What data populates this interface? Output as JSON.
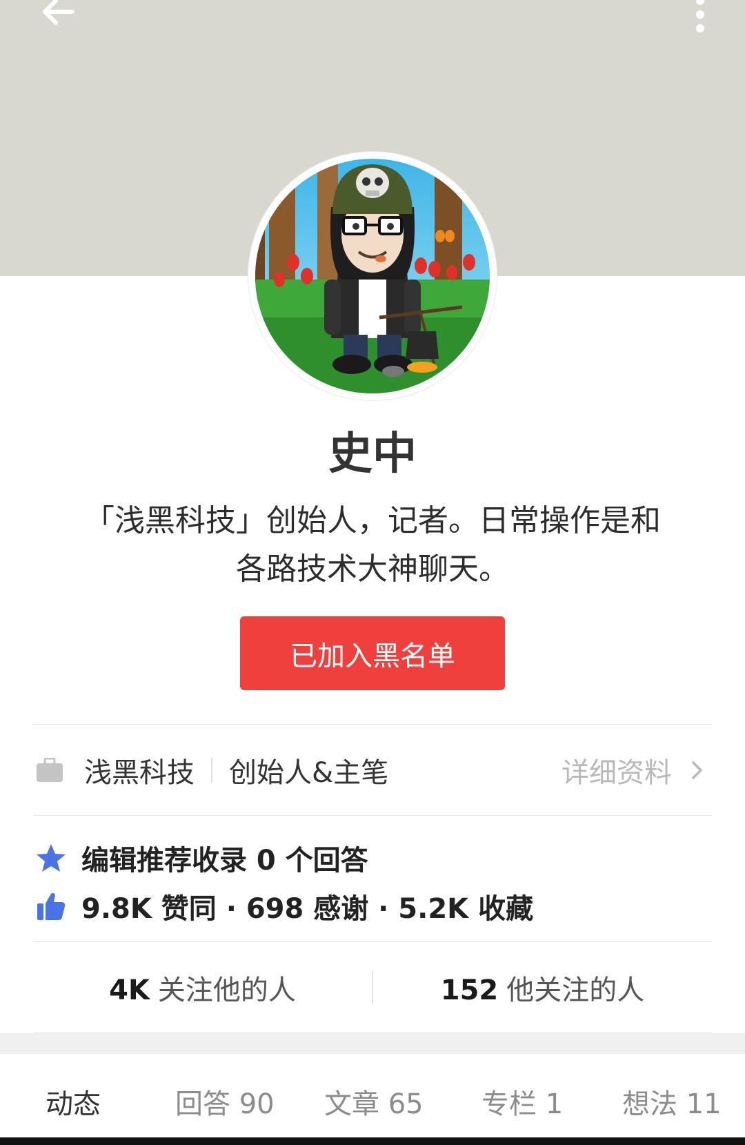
{
  "header": {
    "back_icon": "arrow-left-icon",
    "more_icon": "vertical-dots-icon",
    "cover_color": "#d8d7d0"
  },
  "profile": {
    "avatar": "cartoon-avatar",
    "name": "史中",
    "headline": "「浅黑科技」创始人，记者。日常操作是和各路技术大神聊天。",
    "block_button_label": "已加入黑名单",
    "block_button_color": "#f0403d"
  },
  "employment": {
    "icon": "briefcase-icon",
    "company": "浅黑科技",
    "title": "创始人&主笔",
    "detail_link": "详细资料"
  },
  "achievements": {
    "featured": {
      "icon": "star-icon",
      "text": "编辑推荐收录 0 个回答"
    },
    "stats": {
      "icon": "thumbs-up-icon",
      "text": "9.8K 赞同 · 698 感谢 · 5.2K 收藏"
    },
    "accent_color": "#4a74e6"
  },
  "follow": {
    "followers_count": "4K",
    "followers_label": "关注他的人",
    "following_count": "152",
    "following_label": "他关注的人"
  },
  "tabs": [
    {
      "label": "动态",
      "active": true
    },
    {
      "label": "回答 90",
      "active": false
    },
    {
      "label": "文章 65",
      "active": false
    },
    {
      "label": "专栏 1",
      "active": false
    },
    {
      "label": "想法 11",
      "active": false
    }
  ]
}
